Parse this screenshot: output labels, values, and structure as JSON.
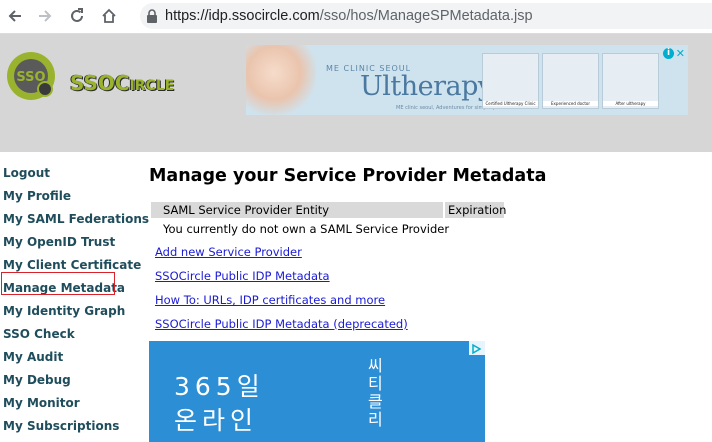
{
  "browser": {
    "url_host": "https://idp.ssocircle.com",
    "url_path": "/sso/hos/ManageSPMetadata.jsp"
  },
  "header": {
    "logo_text": "SSOCircle",
    "logo_badge": "SSO",
    "ad": {
      "brand_small": "ME CLINIC SEOUL",
      "brand": "Ultherapy",
      "tagline": "ME clinic seoul, Adventures for simple procedures",
      "tiles": [
        "Certified Ultherapy Clinic",
        "Experienced doctor",
        "After ultherapy"
      ]
    }
  },
  "sidebar": {
    "items": [
      {
        "label": "Logout"
      },
      {
        "label": "My Profile"
      },
      {
        "label": "My SAML Federations"
      },
      {
        "label": "My OpenID Trust"
      },
      {
        "label": "My Client Certificate"
      },
      {
        "label": "Manage Metadata"
      },
      {
        "label": "My Identity Graph"
      },
      {
        "label": "SSO Check"
      },
      {
        "label": "My Audit"
      },
      {
        "label": "My Debug"
      },
      {
        "label": "My Monitor"
      },
      {
        "label": "My Subscriptions"
      }
    ],
    "highlighted": "Manage Metadata"
  },
  "main": {
    "title": "Manage your Service Provider Metadata",
    "table": {
      "headers": [
        "SAML Service Provider Entity",
        "Expiration"
      ],
      "empty_message": "You currently do not own a SAML Service Provider"
    },
    "links": [
      {
        "label": "Add new Service Provider"
      },
      {
        "label": "SSOCircle Public IDP Metadata"
      },
      {
        "label": "How To: URLs, IDP certificates and more"
      },
      {
        "label": "SSOCircle Public IDP Metadata (deprecated)"
      }
    ]
  },
  "bottom_ad": {
    "line1": "365일",
    "line2": "온라인",
    "vertical": "씨티클리"
  },
  "colors": {
    "sidebar_link": "#1f4d5c",
    "link": "#1a1ad4",
    "header_bg": "#d6d6d6",
    "highlight_border": "#d8232a",
    "logo_green": "#9ab32e"
  }
}
